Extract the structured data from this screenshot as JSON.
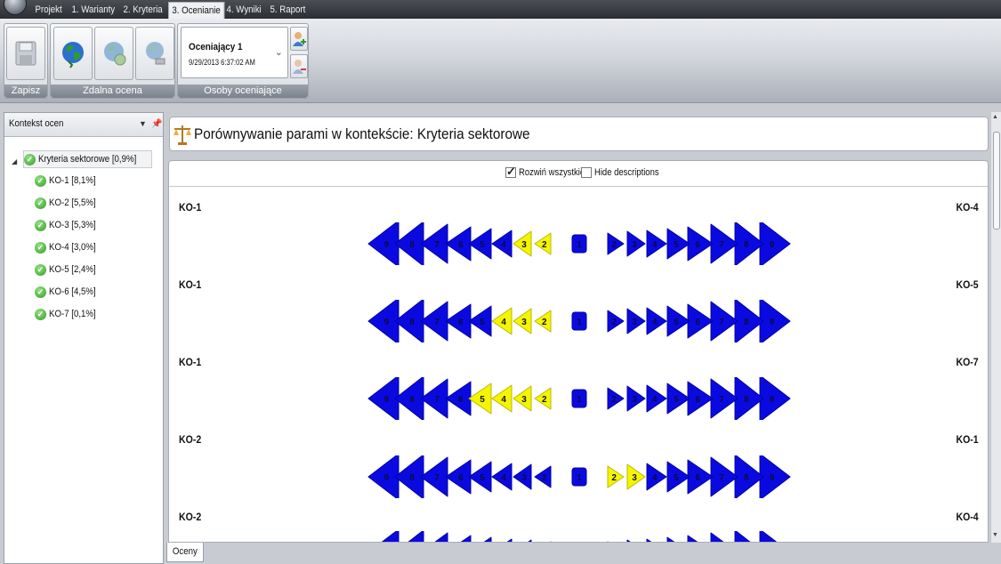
{
  "menu": {
    "tabs": [
      "Projekt",
      "1. Warianty",
      "2. Kryteria",
      "3. Ocenianie",
      "4. Wyniki",
      "5. Raport"
    ],
    "active_tab": "3. Ocenianie"
  },
  "ribbon": {
    "groups": {
      "save": "Zapisz",
      "remote": "Zdalna ocena",
      "raters": "Osoby oceniające"
    },
    "rater_combo": {
      "name": "Oceniający 1",
      "datetime": "9/29/2013 6:37:02 AM"
    }
  },
  "left_panel": {
    "title": "Kontekst ocen",
    "root": "Kryteria sektorowe [0,9%]",
    "items": [
      "KO-1 [8,1%]",
      "KO-2 [5,5%]",
      "KO-3 [5,3%]",
      "KO-4 [3,0%]",
      "KO-5 [2,4%]",
      "KO-6 [4,5%]",
      "KO-7 [0,1%]"
    ]
  },
  "main": {
    "title": "Porównywanie parami w kontekście: Kryteria sektorowe",
    "expand_all": {
      "label": "Rozwiń wszystkie",
      "checked": true
    },
    "hide_descriptions": {
      "label": "Hide descriptions",
      "checked": false
    }
  },
  "comparisons": [
    {
      "left": "KO-1",
      "right": "KO-4",
      "selected": "L3"
    },
    {
      "left": "KO-1",
      "right": "KO-5",
      "selected": "L4"
    },
    {
      "left": "KO-1",
      "right": "KO-7",
      "selected": "L5"
    },
    {
      "left": "KO-2",
      "right": "KO-1",
      "selected": "R3"
    },
    {
      "left": "KO-2",
      "right": "KO-4",
      "selected": null
    }
  ],
  "scale_values": [
    9,
    8,
    7,
    6,
    5,
    4,
    3,
    2,
    1,
    2,
    3,
    4,
    5,
    6,
    7,
    8,
    9
  ],
  "colors": {
    "arrow": "#0a0ae0",
    "selected": "#f5f500",
    "accent": "#2c9a1e"
  },
  "bottom_tab": "Oceny"
}
